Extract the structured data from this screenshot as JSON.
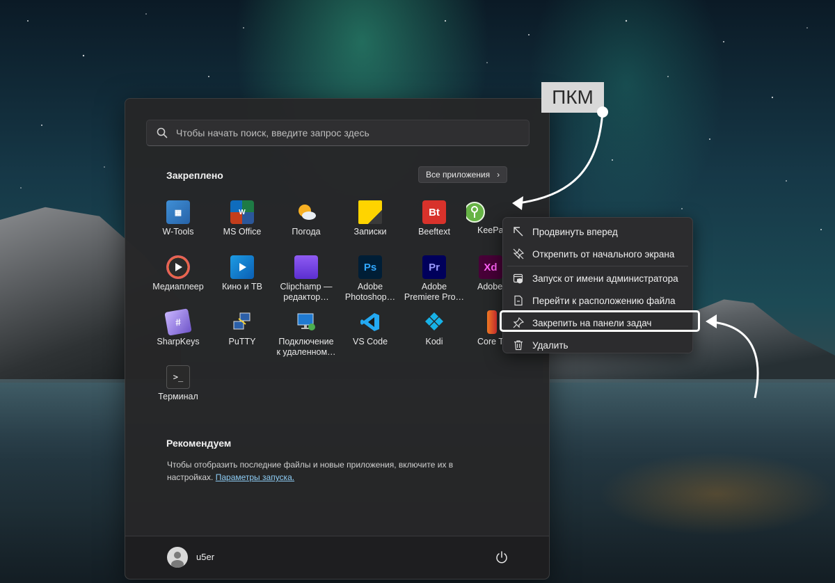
{
  "search": {
    "placeholder": "Чтобы начать поиск, введите запрос здесь"
  },
  "pinned": {
    "title": "Закреплено",
    "all_apps_label": "Все приложения",
    "apps": [
      {
        "label": "W-Tools",
        "icon": "w-tools-icon"
      },
      {
        "label": "MS Office",
        "icon": "ms-office-icon"
      },
      {
        "label": "Погода",
        "icon": "weather-icon"
      },
      {
        "label": "Записки",
        "icon": "sticky-notes-icon"
      },
      {
        "label": "Beeftext",
        "icon": "beeftext-icon",
        "glyph": "Bt"
      },
      {
        "label": "KeePass",
        "icon": "keepass-icon"
      },
      {
        "label": "Медиаплеер",
        "icon": "media-player-icon"
      },
      {
        "label": "Кино и ТВ",
        "icon": "movies-tv-icon"
      },
      {
        "label": "Clipchamp — редактор…",
        "icon": "clipchamp-icon"
      },
      {
        "label": "Adobe Photoshop…",
        "icon": "photoshop-icon",
        "glyph": "Ps"
      },
      {
        "label": "Adobe Premiere Pro…",
        "icon": "premiere-icon",
        "glyph": "Pr"
      },
      {
        "label": "Adobe",
        "icon": "adobe-xd-icon",
        "glyph": "Xd"
      },
      {
        "label": "SharpKeys",
        "icon": "sharpkeys-icon"
      },
      {
        "label": "PuTTY",
        "icon": "putty-icon"
      },
      {
        "label": "Подключение к удаленном…",
        "icon": "remote-desktop-icon"
      },
      {
        "label": "VS Code",
        "icon": "vscode-icon"
      },
      {
        "label": "Kodi",
        "icon": "kodi-icon"
      },
      {
        "label": "Core Te",
        "icon": "core-temp-icon"
      },
      {
        "label": "Терминал",
        "icon": "terminal-icon",
        "glyph": ">_"
      }
    ]
  },
  "recommended": {
    "title": "Рекомендуем",
    "text": "Чтобы отобразить последние файлы и новые приложения, включите их в настройках.",
    "link": "Параметры запуска."
  },
  "user": {
    "name": "u5er"
  },
  "context_menu": {
    "items": [
      {
        "label": "Продвинуть вперед",
        "icon": "move-to-top-icon"
      },
      {
        "label": "Открепить от начального экрана",
        "icon": "unpin-icon"
      },
      {
        "label": "Запуск от имени администратора",
        "icon": "run-as-admin-icon"
      },
      {
        "label": "Перейти к расположению файла",
        "icon": "open-file-location-icon"
      },
      {
        "label": "Закрепить на панели задач",
        "icon": "pin-taskbar-icon"
      },
      {
        "label": "Удалить",
        "icon": "trash-icon"
      }
    ]
  },
  "annotation": {
    "label": "ПКМ"
  }
}
